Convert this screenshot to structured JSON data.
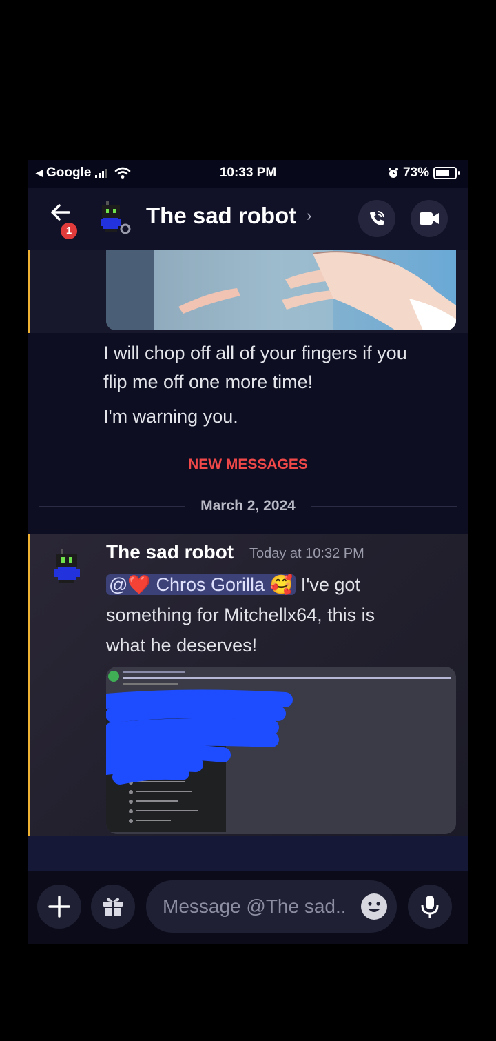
{
  "status_bar": {
    "carrier": "Google",
    "time": "10:33 PM",
    "battery": "73%"
  },
  "header": {
    "title": "The sad robot",
    "back_badge": "1"
  },
  "messages": {
    "previous": {
      "line1": "I will chop off all of your fingers if you",
      "line2": "flip me off one more time!",
      "line3": "I'm warning you."
    },
    "new_messages_divider": "NEW MESSAGES",
    "date_divider": "March 2, 2024",
    "latest": {
      "author": "The sad robot",
      "timestamp": "Today at 10:32 PM",
      "mention": "@❤️ Chros Gorilla 🥰",
      "text_after_mention": " I've got",
      "line2": "something for Mitchellx64, this is",
      "line3": "what he deserves!"
    }
  },
  "composer": {
    "placeholder": "Message @The sad.."
  },
  "colors": {
    "accent_bar": "#f0b232",
    "new_messages": "#f04848",
    "mention_bg": "#3c4278",
    "redaction_scribble": "#1e4dff"
  }
}
